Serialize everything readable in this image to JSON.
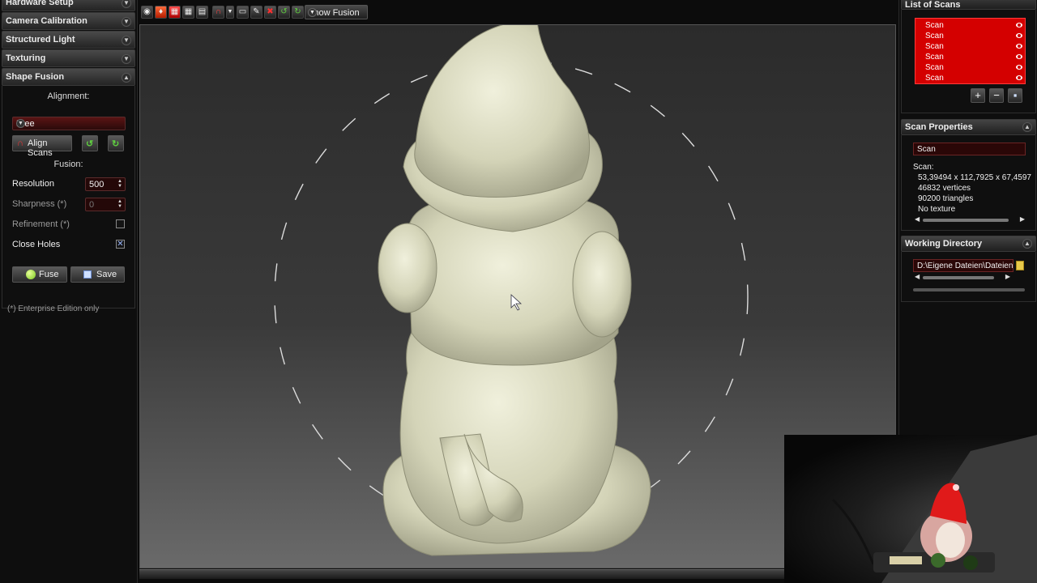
{
  "left_panel": {
    "sections": [
      {
        "title": "Hardware Setup"
      },
      {
        "title": "Camera Calibration"
      },
      {
        "title": "Structured Light"
      },
      {
        "title": "Texturing"
      },
      {
        "title": "Shape Fusion"
      }
    ],
    "shape_fusion": {
      "alignment_label": "Alignment:",
      "alignment_value": "Free",
      "align_button": "Align Scans",
      "fusion_label": "Fusion:",
      "resolution_label": "Resolution",
      "resolution_value": "500",
      "sharpness_label": "Sharpness (*)",
      "sharpness_value": "0",
      "refinement_label": "Refinement (*)",
      "refinement_checked": false,
      "close_holes_label": "Close Holes",
      "close_holes_checked": true,
      "fuse_button": "Fuse",
      "save_button": "Save",
      "footnote": "(*) Enterprise Edition only"
    }
  },
  "toolbar": {
    "show_fusion_label": "Show Fusion",
    "icons": [
      "eye-icon",
      "light-icon",
      "grid-red-icon",
      "grid-icon",
      "table-icon",
      "magnet-icon",
      "camera-icon",
      "brush-icon",
      "delete-icon",
      "undo-icon",
      "redo-icon"
    ]
  },
  "right_panel": {
    "list_of_scans": {
      "title": "List of Scans",
      "items": [
        "Scan",
        "Scan",
        "Scan",
        "Scan",
        "Scan",
        "Scan"
      ]
    },
    "scan_properties": {
      "title": "Scan Properties",
      "name_value": "Scan",
      "label": "Scan:",
      "dimensions": "53,39494 x 112,7925 x 67,4597",
      "vertices": "46832 vertices",
      "triangles": "90200 triangles",
      "texture": "No texture"
    },
    "working_directory": {
      "title": "Working Directory",
      "path": "D:\\Eigene Dateien\\Dateien"
    }
  },
  "colors": {
    "accent_red": "#d40000",
    "model_color": "#e6e6cc"
  }
}
